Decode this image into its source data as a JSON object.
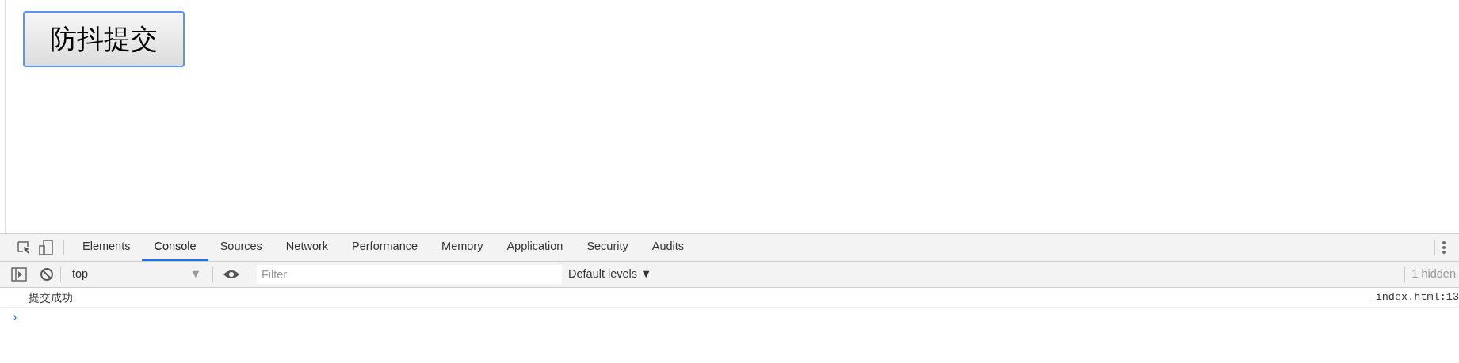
{
  "page": {
    "button": {
      "label": "防抖提交"
    }
  },
  "devtools": {
    "tabs": [
      {
        "label": "Elements",
        "selected": false
      },
      {
        "label": "Console",
        "selected": true
      },
      {
        "label": "Sources",
        "selected": false
      },
      {
        "label": "Network",
        "selected": false
      },
      {
        "label": "Performance",
        "selected": false
      },
      {
        "label": "Memory",
        "selected": false
      },
      {
        "label": "Application",
        "selected": false
      },
      {
        "label": "Security",
        "selected": false
      },
      {
        "label": "Audits",
        "selected": false
      }
    ],
    "toolbar": {
      "context": "top",
      "context_caret": "▼",
      "filter": {
        "placeholder": "Filter"
      },
      "levels": "Default levels ▼",
      "hidden_count": "1 hidden"
    },
    "messages": [
      {
        "text": "提交成功",
        "source": "index.html:13"
      }
    ],
    "prompt": "›"
  }
}
